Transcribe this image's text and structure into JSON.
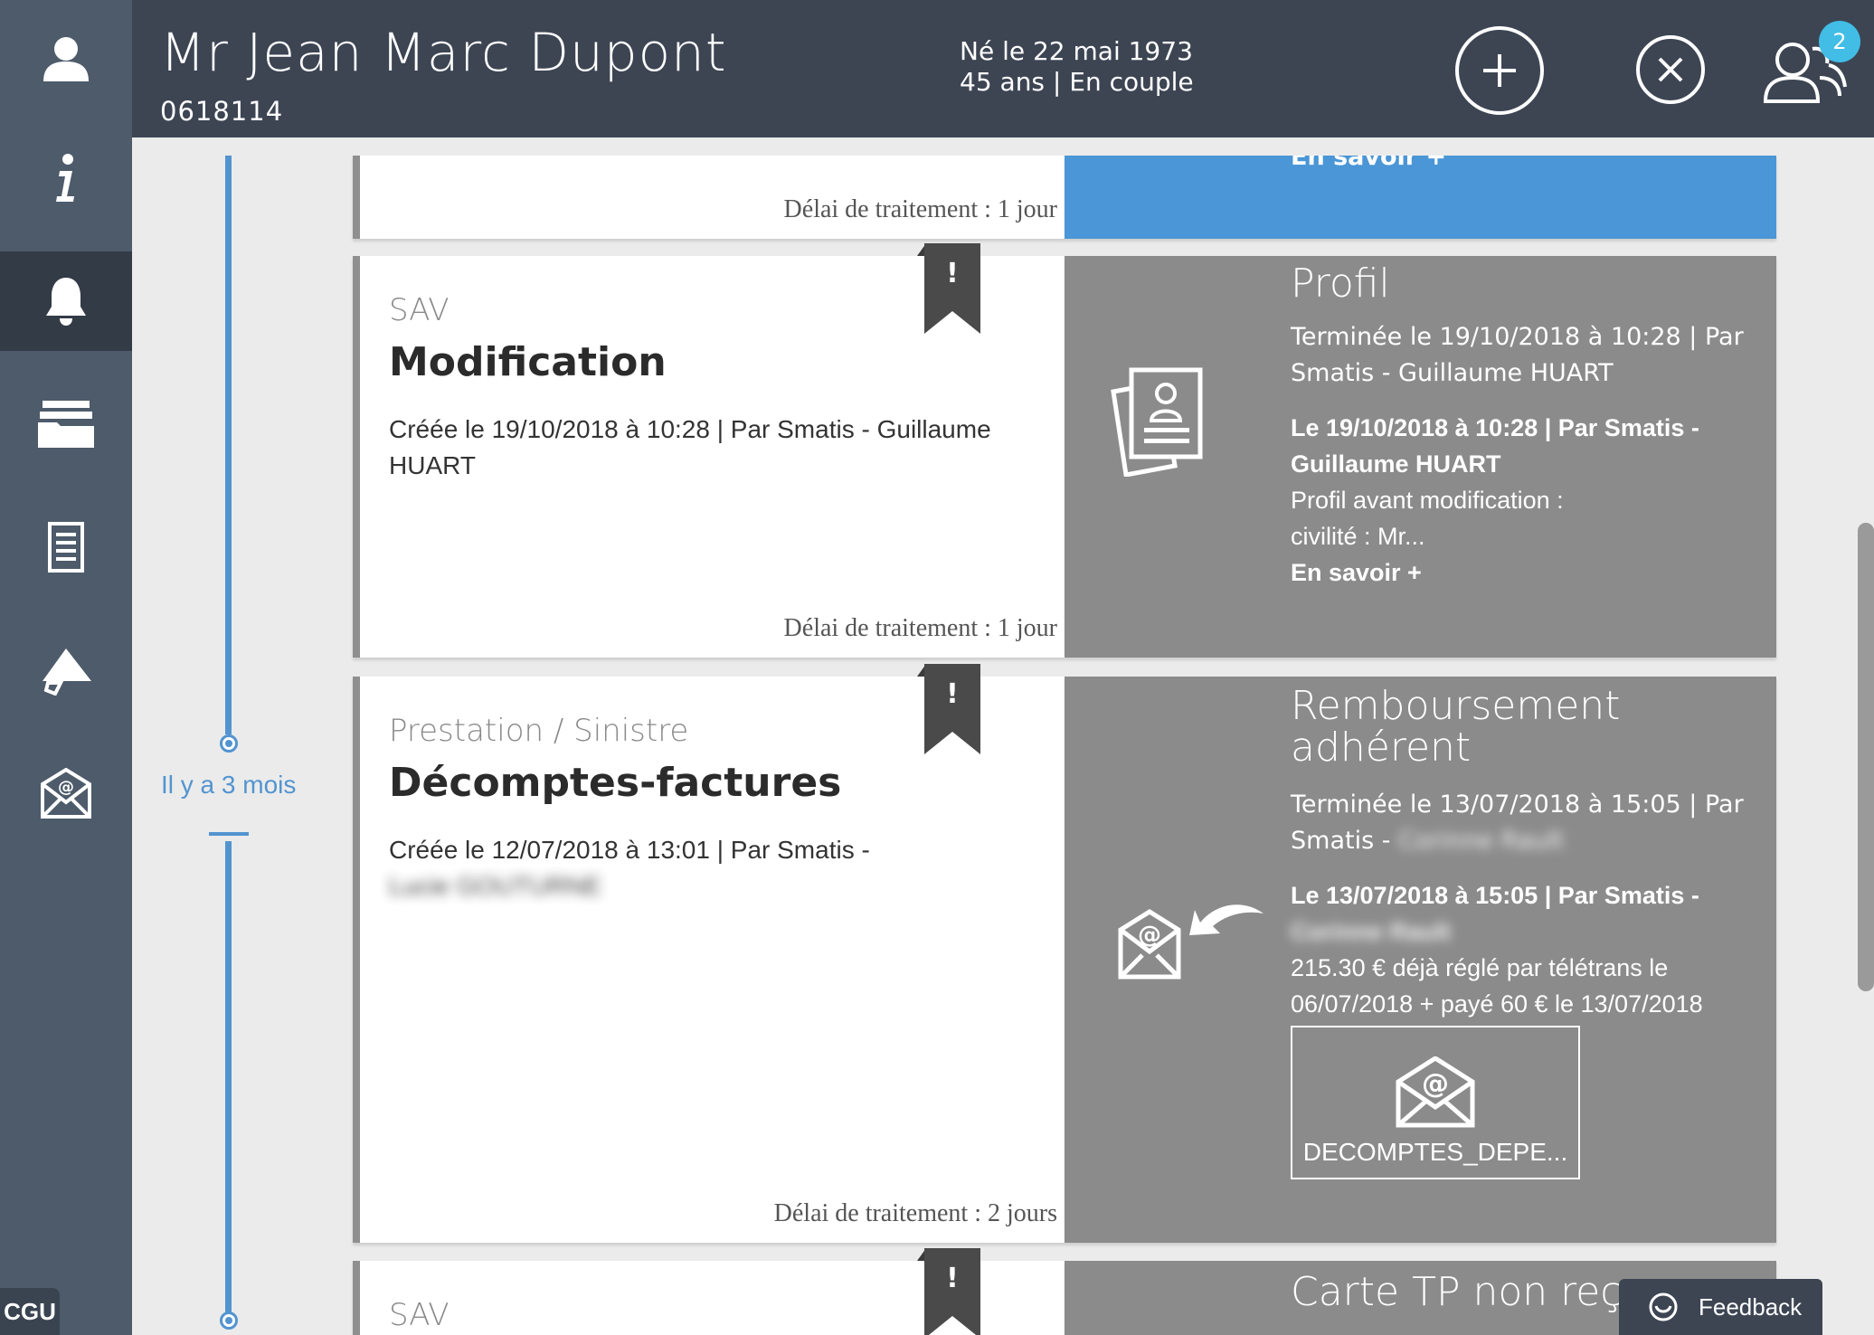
{
  "header": {
    "client_name": "Mr Jean Marc Dupont",
    "client_id": "0618114",
    "birth_line": "Né le 22 mai 1973",
    "age_line": "45 ans | En couple",
    "notifications_count": "2"
  },
  "sidebar": {
    "items": [
      {
        "icon": "user-icon"
      },
      {
        "icon": "info-icon"
      },
      {
        "icon": "bell-icon",
        "active": true
      },
      {
        "icon": "folders-icon"
      },
      {
        "icon": "document-icon"
      },
      {
        "icon": "megaphone-icon"
      },
      {
        "icon": "mail-at-icon"
      }
    ],
    "cgu_label": "CGU"
  },
  "timeline": {
    "label": "Il y a 3 mois"
  },
  "cards": [
    {
      "delay": "Délai de traitement : 1 jour",
      "right_partial": "En savoir +"
    },
    {
      "category": "SAV",
      "title": "Modification",
      "created": "Créée le 19/10/2018 à 10:28 | Par Smatis - Guillaume HUART",
      "delay": "Délai de traitement : 1 jour",
      "right": {
        "title": "Profil",
        "completed": "Terminée le 19/10/2018 à 10:28 | Par Smatis - Guillaume HUART",
        "event": "Le 19/10/2018 à 10:28 | Par Smatis - Guillaume HUART",
        "desc1": "Profil avant modification :",
        "desc2": "civilité : Mr...",
        "more": "En savoir +"
      }
    },
    {
      "category": "Prestation / Sinistre",
      "title": "Décomptes-factures",
      "created": "Créée le 12/07/2018 à 13:01 | Par Smatis -",
      "created_blurred": "Lucie GOUTURNE",
      "delay": "Délai de traitement : 2 jours",
      "right": {
        "title_line1": "Remboursement",
        "title_line2": "adhérent",
        "completed": "Terminée le 13/07/2018 à 15:05 | Par Smatis -",
        "completed_blurred": "Corinne Rault",
        "event": "Le 13/07/2018 à 15:05 | Par Smatis -",
        "event_blurred": "Corinne Rault",
        "desc": "215.30 € déjà réglé par télétrans le 06/07/2018 + payé 60 € le 13/07/2018",
        "attachment": "DECOMPTES_DEPE..."
      }
    },
    {
      "category": "SAV",
      "right": {
        "title": "Carte TP non reç"
      }
    }
  ],
  "feedback": {
    "label": "Feedback"
  },
  "colors": {
    "sidebar": "#4d5b6b",
    "header": "#3d4553",
    "accent_blue": "#4a96d6",
    "timeline": "#5294d0",
    "badge": "#41bde6",
    "card_right_gray": "#8b8b8b"
  }
}
